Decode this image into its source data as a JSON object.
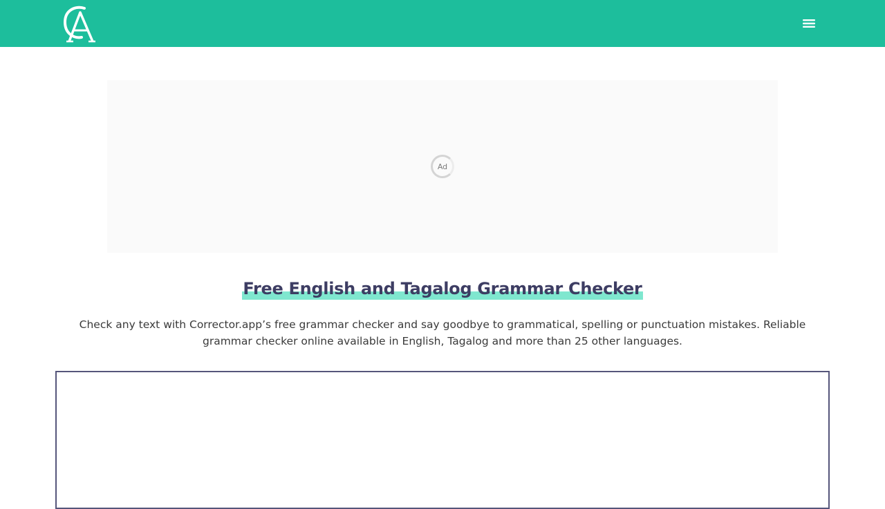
{
  "header": {
    "logo_icon": "corrector-app-logo",
    "menu_icon": "hamburger-menu-icon",
    "background_color": "#1dbe9c"
  },
  "ad": {
    "label": "Ad"
  },
  "main": {
    "title": "Free English and Tagalog Grammar Checker",
    "subtitle": "Check any text with Corrector.app’s free grammar checker and say goodbye to grammatical, spelling or punctuation mistakes. Reliable grammar checker online available in English, Tagalog and more than 25 other languages.",
    "editor_value": "",
    "highlight_color": "#7fe7cf",
    "title_color": "#3d3d63"
  }
}
